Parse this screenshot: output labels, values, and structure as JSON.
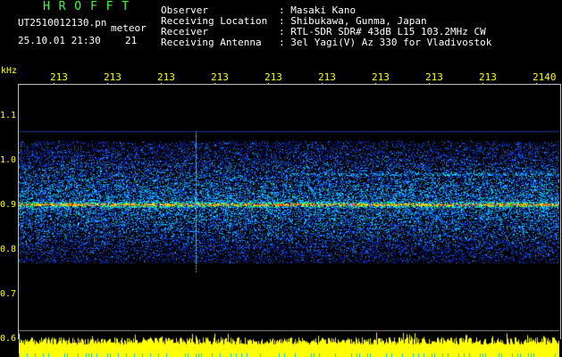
{
  "header": {
    "title": "H R O F F T",
    "filename": "UT2510012130.pn",
    "meteor_label": "meteor",
    "datetime": "25.10.01 21:30",
    "count": "21"
  },
  "info": {
    "labels": [
      "Observer",
      "Receiving Location",
      "Receiver",
      "Receiving Antenna"
    ],
    "values": [
      ": Masaki Kano",
      ": Shibukawa, Gunma, Japan",
      ": RTL-SDR SDR# 43dB L15 103.2MHz CW",
      ": 3el Yagi(V) Az 330 for Vladivostok"
    ]
  },
  "axes": {
    "y_unit": "kHz",
    "y_ticks": [
      "1.1",
      "1.0",
      "0.9",
      "0.8",
      "0.7",
      "0.6"
    ],
    "x_ticks": [
      "213",
      "213",
      "213",
      "213",
      "213",
      "213",
      "213",
      "213",
      "213",
      "2140"
    ]
  },
  "colors": {
    "axis": "#ffff00",
    "title": "#3cff3c",
    "trace": "#ffff00",
    "background": "#000000"
  }
}
